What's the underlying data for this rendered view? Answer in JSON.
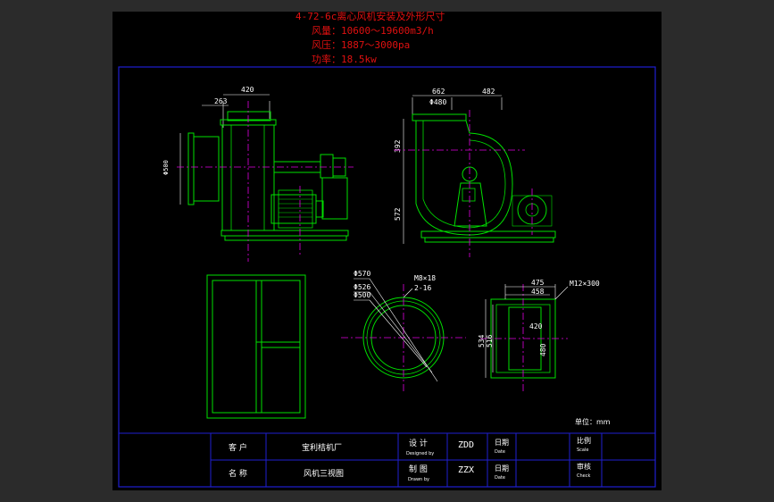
{
  "header": {
    "title": "4-72-6c离心风机安装及外形尺寸",
    "flow": "风量：10600～19600m3/h",
    "pressure": "风压：1887～3000pa",
    "power": "功率：18.5kw"
  },
  "side_view": {
    "dim_top": "420",
    "dim_left": "263",
    "dim_height": "Φ500"
  },
  "front_view": {
    "dim_a": "662",
    "dim_b": "482",
    "dim_c": "Φ480",
    "dim_d": "392",
    "dim_e": "572"
  },
  "flange_view": {
    "d1": "Φ570",
    "d2": "Φ526",
    "d3": "Φ500",
    "bolt": "M8×18",
    "holes": "2-16"
  },
  "outlet_view": {
    "w1": "475",
    "w2": "458",
    "w_in": "420",
    "h1": "534",
    "h2": "516",
    "h_in": "480",
    "bolt": "M12×300"
  },
  "unit_label": "单位：mm",
  "title_block": {
    "client_label": "客  户",
    "client_value": "宝利桔机厂",
    "name_label": "名  称",
    "name_value": "风机三视图",
    "design_label": "设  计",
    "design_sub": "Designed by",
    "design_value": "ZDD",
    "draw_label": "制  图",
    "draw_sub": "Drawn by",
    "draw_value": "ZZX",
    "date_label1": "日期",
    "date_sub1": "Date",
    "date_label2": "日期",
    "date_sub2": "Date",
    "scale_label": "比例",
    "scale_sub": "Scale",
    "check_label": "审核",
    "check_sub": "Check"
  },
  "colors": {
    "background": "#000000",
    "frame": "#1f1fd0",
    "green": "#00e000",
    "magenta": "#e000e0",
    "red": "#e01010",
    "white": "#ffffff"
  }
}
